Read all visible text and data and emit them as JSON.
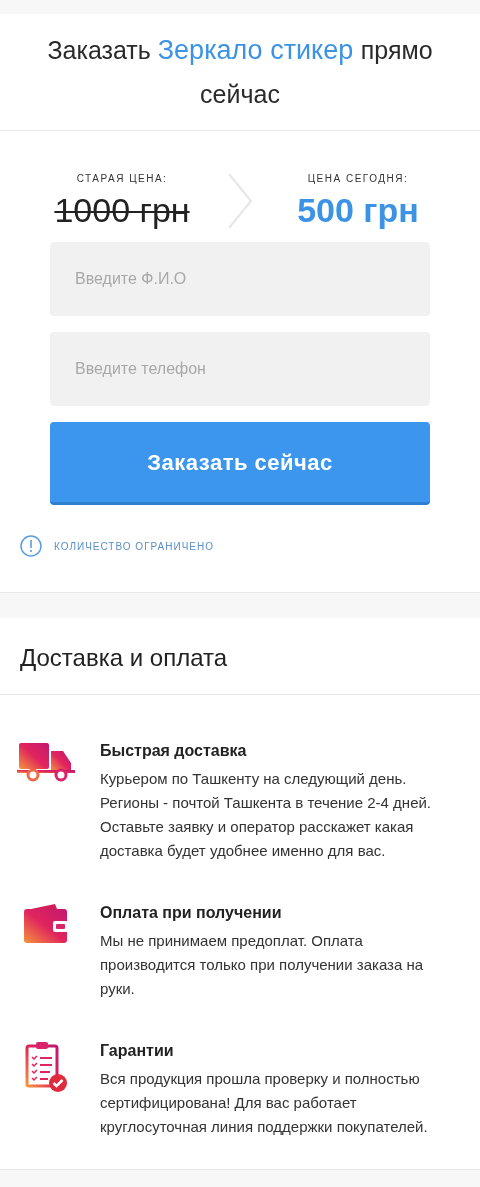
{
  "order": {
    "title_parts": [
      {
        "text": "Заказать",
        "highlight": false
      },
      {
        "text": "Зеркало стикер",
        "highlight": true
      },
      {
        "text": "прямо сейчас",
        "highlight": false
      }
    ],
    "old_price": {
      "label": "СТАРАЯ ЦЕНА:",
      "value": "1000 грн"
    },
    "new_price": {
      "label": "ЦЕНА СЕГОДНЯ:",
      "value": "500 грн"
    },
    "fields": [
      {
        "placeholder": "Введите Ф.И.О"
      },
      {
        "placeholder": "Введите телефон"
      }
    ],
    "button": "Заказать сейчас",
    "notice": "КОЛИЧЕСТВО ОГРАНИЧЕНО"
  },
  "delivery": {
    "title": "Доставка и оплата",
    "features": [
      {
        "kind": "truck",
        "title": "Быстрая доставка",
        "text": "Курьером по Ташкенту на следующий день. Регионы - почтой Ташкента в течение 2-4 дней. Оставьте заявку и оператор расскажет какая доставка будет удобнее именно для вас."
      },
      {
        "kind": "wallet",
        "title": "Оплата при получении",
        "text": "Мы не принимаем предоплат. Оплата производится только при получении заказа на руки."
      },
      {
        "kind": "clipboard",
        "title": "Гарантии",
        "text": "Вся продукция прошла проверку и полностью сертифицирована! Для вас работает круглосуточная линия поддержки покупателей."
      }
    ]
  }
}
